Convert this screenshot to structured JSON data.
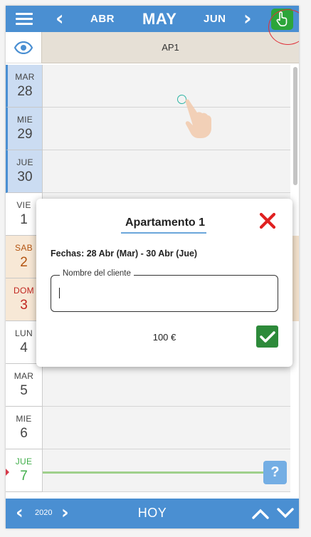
{
  "topbar": {
    "prev_month": "ABR",
    "current_month": "MAY",
    "next_month": "JUN"
  },
  "header": {
    "apartment_code": "AP1"
  },
  "days": [
    {
      "name": "MAR",
      "num": "28"
    },
    {
      "name": "MIE",
      "num": "29"
    },
    {
      "name": "JUE",
      "num": "30"
    },
    {
      "name": "VIE",
      "num": "1"
    },
    {
      "name": "SAB",
      "num": "2"
    },
    {
      "name": "DOM",
      "num": "3"
    },
    {
      "name": "LUN",
      "num": "4"
    },
    {
      "name": "MAR",
      "num": "5"
    },
    {
      "name": "MIE",
      "num": "6"
    },
    {
      "name": "JUE",
      "num": "7"
    }
  ],
  "help": {
    "label": "?"
  },
  "bottombar": {
    "year": "2020",
    "today_label": "HOY"
  },
  "modal": {
    "title": "Apartamento 1",
    "dates": "Fechas: 28 Abr (Mar) - 30 Abr (Jue)",
    "client_label": "Nombre del cliente",
    "client_value": "",
    "price": "100 €"
  },
  "colors": {
    "bar_blue": "#4a8fd2",
    "confirm_green": "#2d8a3a",
    "close_red": "#e02020",
    "weekend_text": "#b35410",
    "today_green": "#3fae49"
  }
}
